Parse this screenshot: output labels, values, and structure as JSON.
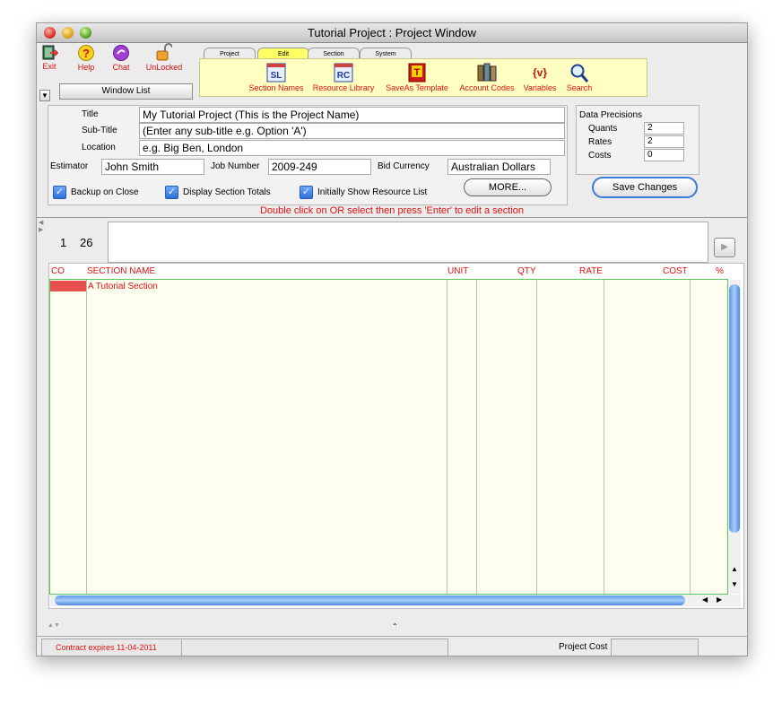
{
  "window": {
    "title": "Tutorial Project : Project Window"
  },
  "toolbar": {
    "exit": "Exit",
    "help": "Help",
    "chat": "Chat",
    "lock": "UnLocked",
    "window_list": "Window List"
  },
  "ribbon": {
    "tabs": [
      "Project",
      "Edit",
      "Section",
      "System"
    ],
    "active_tab": "Edit",
    "tools": [
      {
        "label": "Section Names",
        "icon": "section-names-icon"
      },
      {
        "label": "Resource Library",
        "icon": "resource-library-icon"
      },
      {
        "label": "SaveAs Template",
        "icon": "template-icon"
      },
      {
        "label": "Account Codes",
        "icon": "account-codes-icon"
      },
      {
        "label": "Variables",
        "icon": "variables-icon"
      },
      {
        "label": "Search",
        "icon": "search-icon"
      }
    ],
    "section_icon_text": "SL",
    "resource_icon_text": "RC",
    "template_icon_text": "T",
    "variables_icon_text": "{v}"
  },
  "project": {
    "title_label": "Title",
    "title_value": "My Tutorial Project (This is the Project Name)",
    "subtitle_label": "Sub-Title",
    "subtitle_value": "(Enter any sub-title e.g. Option 'A')",
    "location_label": "Location",
    "location_value": "e.g. Big Ben, London",
    "estimator_label": "Estimator",
    "estimator_value": "John Smith",
    "job_label": "Job Number",
    "job_value": "2009-249",
    "currency_label": "Bid Currency",
    "currency_value": "Australian Dollars",
    "backup_label": "Backup on Close",
    "totals_label": "Display Section Totals",
    "resource_label": "Initially Show Resource List",
    "more_button": "MORE...",
    "hint": "Double click on OR select then press 'Enter' to edit a section"
  },
  "precisions": {
    "heading": "Data Precisions",
    "quants_label": "Quants",
    "quants_value": "2",
    "rates_label": "Rates",
    "rates_value": "2",
    "costs_label": "Costs",
    "costs_value": "0",
    "save_button": "Save Changes"
  },
  "nav": {
    "first": "1",
    "second": "26"
  },
  "grid": {
    "columns": [
      "CO",
      "SECTION NAME",
      "UNIT",
      "QTY",
      "RATE",
      "COST",
      "%"
    ],
    "rows": [
      {
        "co": "",
        "name": "A Tutorial Section",
        "unit": "",
        "qty": "",
        "rate": "",
        "cost": "",
        "pct": ""
      }
    ]
  },
  "status": {
    "contract": "Contract expires 11-04-2011",
    "project_cost_label": "Project Cost"
  },
  "colors": {
    "accent_red": "#e01010",
    "ribbon_bg": "#ffffc2",
    "grid_bg": "#fffff0",
    "grid_border": "#5ac85a"
  }
}
